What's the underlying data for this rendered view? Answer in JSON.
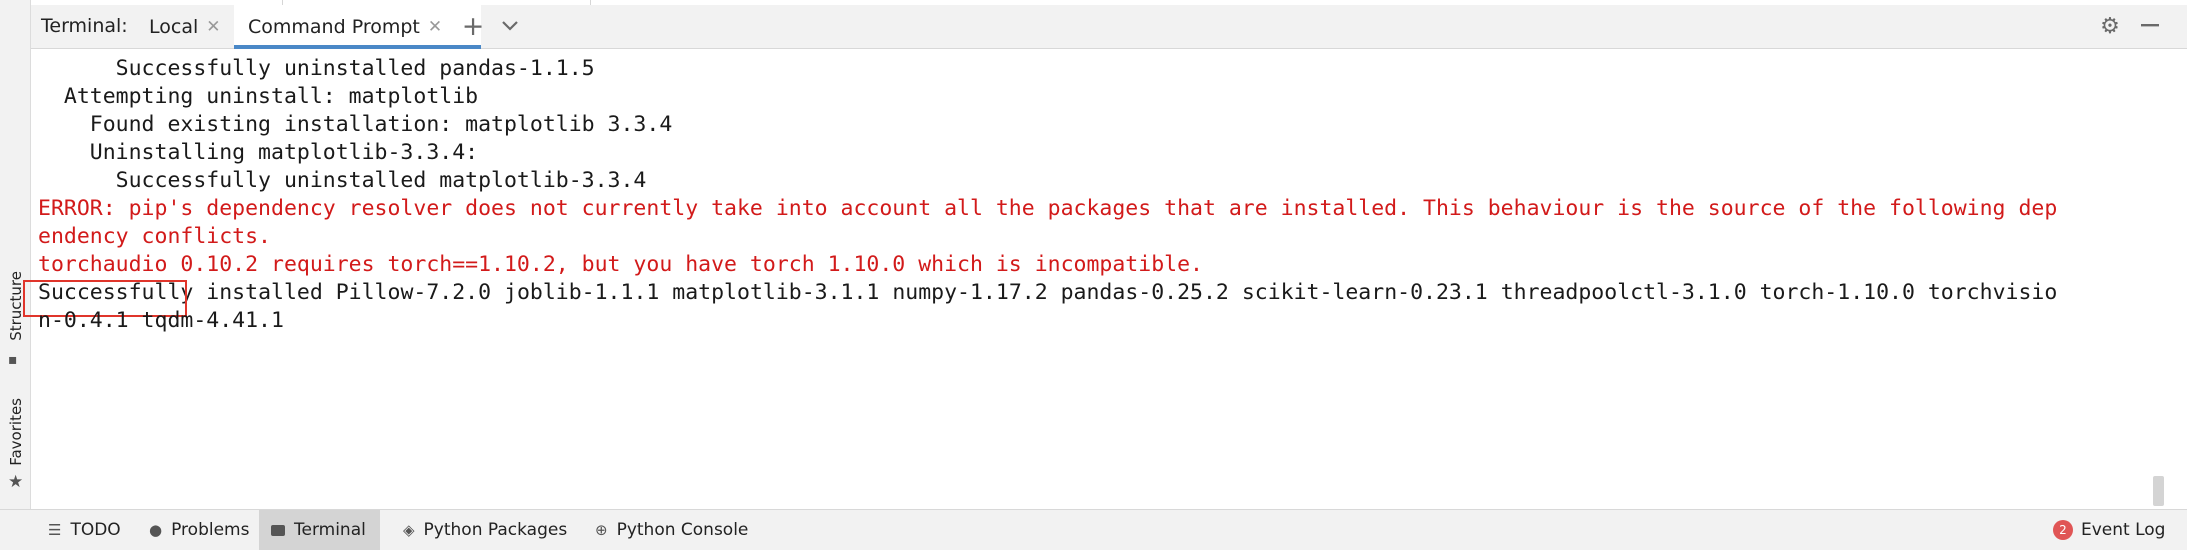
{
  "window": {
    "colors": {
      "accent": "#4a88c7",
      "error_text": "#d21a1a",
      "highlight_box": "#e0352b",
      "panel_bg": "#f2f2f2"
    }
  },
  "side_strip": {
    "structure_label": "Structure",
    "favorites_label": "Favorites",
    "icons": [
      "structure-icon",
      "star-icon"
    ]
  },
  "terminal_header": {
    "title": "Terminal:",
    "tabs": [
      {
        "label": "Local",
        "active": false
      },
      {
        "label": "Command Prompt",
        "active": true
      }
    ],
    "icons": [
      "plus-icon",
      "chevron-down-icon",
      "gear-icon",
      "minimize-icon"
    ]
  },
  "terminal": {
    "lines": [
      {
        "text": "      Successfully uninstalled pandas-1.1.5",
        "type": "normal"
      },
      {
        "text": "  Attempting uninstall: matplotlib",
        "type": "normal"
      },
      {
        "text": "    Found existing installation: matplotlib 3.3.4",
        "type": "normal"
      },
      {
        "text": "    Uninstalling matplotlib-3.3.4:",
        "type": "normal"
      },
      {
        "text": "      Successfully uninstalled matplotlib-3.3.4",
        "type": "normal"
      },
      {
        "text": "ERROR: pip's dependency resolver does not currently take into account all the packages that are installed. This behaviour is the source of the following dep",
        "type": "error"
      },
      {
        "text": "endency conflicts.",
        "type": "error"
      },
      {
        "text": "torchaudio 0.10.2 requires torch==1.10.2, but you have torch 1.10.0 which is incompatible.",
        "type": "error"
      },
      {
        "text": "Successfully",
        "rest": " installed Pillow-7.2.0 joblib-1.1.1 matplotlib-3.1.1 numpy-1.17.2 pandas-0.25.2 scikit-learn-0.23.1 threadpoolctl-3.1.0 torch-1.10.0 torchvisio",
        "type": "highlighted"
      },
      {
        "text": "n-0.4.1 tqdm-4.41.1",
        "type": "normal"
      }
    ]
  },
  "bottom_bar": {
    "items": [
      {
        "label": "TODO",
        "icon": "list-icon"
      },
      {
        "label": "Problems",
        "icon": "problems-icon"
      },
      {
        "label": "Terminal",
        "icon": "terminal-icon",
        "active": true
      },
      {
        "label": "Python Packages",
        "icon": "packages-icon"
      },
      {
        "label": "Python Console",
        "icon": "python-icon"
      }
    ],
    "event_log": {
      "label": "Event Log",
      "count": "2"
    }
  }
}
